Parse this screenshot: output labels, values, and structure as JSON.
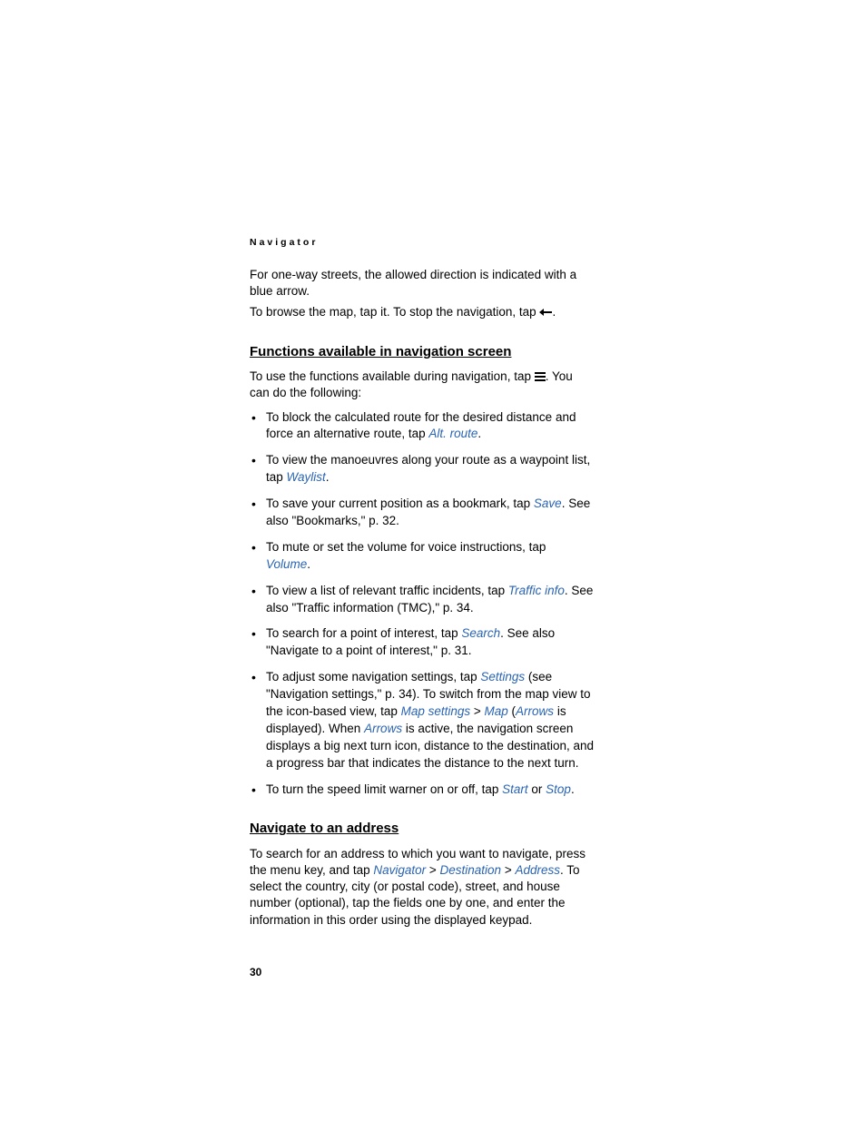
{
  "chapter": "Navigator",
  "intro": {
    "p1": "For one-way streets, the allowed direction is indicated with a blue arrow.",
    "p2a": "To browse the map, tap it. To stop the navigation, tap ",
    "p2b": "."
  },
  "section1": {
    "title": "Functions available in navigation screen",
    "lead_a": "To use the functions available during navigation, tap ",
    "lead_b": ". You can do the following:",
    "items": [
      {
        "pre": "To block the calculated route for the desired distance and force an alternative route, tap ",
        "link": "Alt. route",
        "post": "."
      },
      {
        "pre": "To view the manoeuvres along your route as a waypoint list, tap ",
        "link": "Waylist",
        "post": "."
      },
      {
        "pre": "To save your current position as a bookmark, tap ",
        "link": "Save",
        "post": ". See also \"Bookmarks,\" p. 32."
      },
      {
        "pre": "To mute or set the volume for voice instructions, tap ",
        "link": "Volume",
        "post": "."
      },
      {
        "pre": "To view a list of relevant traffic incidents, tap ",
        "link": "Traffic info",
        "post": ". See also \"Traffic information (TMC),\" p. 34."
      },
      {
        "pre": "To search for a point of interest, tap ",
        "link": "Search",
        "post": ". See also \"Navigate to a point of interest,\" p. 31."
      }
    ],
    "settings": {
      "pre": "To adjust some navigation settings, tap ",
      "l1": "Settings",
      "mid1": " (see \"Navigation settings,\" p. 34). To switch from the map view to the icon-based view, tap ",
      "l2": "Map settings",
      "sep1": " > ",
      "l3": "Map",
      "paren_open": " (",
      "l4": "Arrows",
      "mid2": " is displayed). When ",
      "l5": "Arrows",
      "post": " is active, the navigation screen displays a big next turn icon, distance to the destination, and a progress bar that indicates the distance to the next turn."
    },
    "speed": {
      "pre": "To turn the speed limit warner on or off, tap ",
      "l1": "Start",
      "mid": " or ",
      "l2": "Stop",
      "post": "."
    }
  },
  "section2": {
    "title": "Navigate to an address",
    "pre": "To search for an address to which you want to navigate, press the menu key, and tap ",
    "l1": "Navigator",
    "sep1": " > ",
    "l2": "Destination",
    "sep2": " > ",
    "l3": "Address",
    "post": ". To select the country, city (or postal code), street, and house number (optional), tap the fields one by one, and enter the information in this order using the displayed keypad."
  },
  "page_number": "30"
}
